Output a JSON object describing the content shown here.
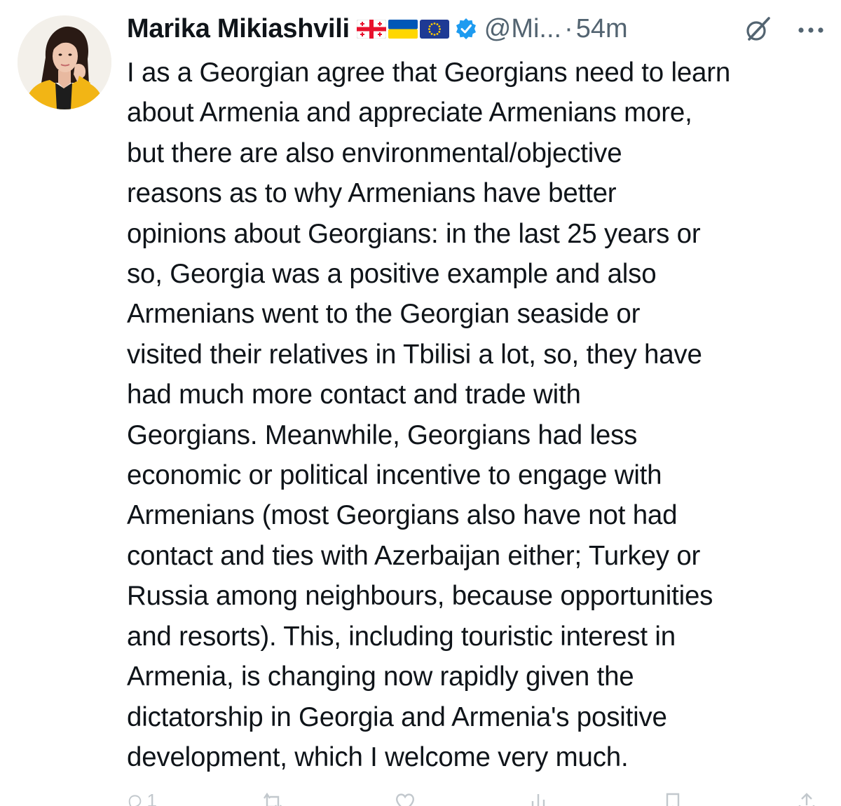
{
  "post": {
    "author_name": "Marika Mikiashvili",
    "flags": [
      "georgia-flag-icon",
      "ukraine-flag-icon",
      "eu-flag-icon"
    ],
    "verified_icon": "verified-badge-icon",
    "handle": "@Mi...",
    "separator": "·",
    "time_ago": "54m",
    "body": "I as a Georgian agree that Georgians need to learn\nabout Armenia and appreciate Armenians more,\nbut there are also environmental/objective\nreasons as to why Armenians have better\nopinions about Georgians: in the last 25 years or\nso, Georgia was a positive example and also\nArmenians went to the Georgian seaside or\nvisited their relatives in Tbilisi a lot, so, they have\nhad much more contact and trade with\nGeorgians. Meanwhile, Georgians had less\neconomic or political incentive to engage with\nArmenians (most Georgians also have not had\ncontact and ties with Azerbaijan either; Turkey or\nRussia among neighbours, because opportunities\nand resorts). This, including touristic interest in\nArmenia, is changing now rapidly given the\ndictatorship in Georgia and Armenia's positive\ndevelopment, which I welcome very much."
  },
  "actions": {
    "reply_count": "1",
    "icons": [
      "reply-icon",
      "repost-icon",
      "like-icon",
      "views-icon",
      "bookmark-icon",
      "share-icon"
    ]
  },
  "colors": {
    "text": "#0f1419",
    "secondary": "#536471",
    "verified": "#1d9bf0",
    "background": "#ffffff"
  }
}
